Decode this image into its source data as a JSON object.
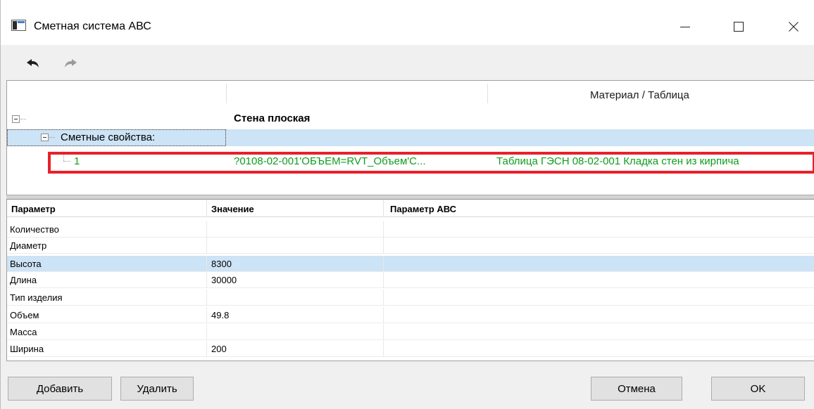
{
  "window": {
    "title": "Сметная система АВС"
  },
  "icons": {
    "app": "app-window-icon",
    "minimize": "minimize-icon",
    "maximize": "maximize-icon",
    "close": "close-icon",
    "undo": "undo-arrow-icon",
    "redo": "redo-arrow-icon"
  },
  "tree": {
    "column_header": "Материал / Таблица",
    "root_label": "Стена плоская",
    "group_label": "Сметные свойства:",
    "item": {
      "name": "1",
      "formula": "?0108-02-001'ОБЪЕМ=RVT_Объем'С...",
      "table": "Таблица ГЭСН 08-02-001 Кладка стен из кирпича"
    }
  },
  "grid": {
    "columns": [
      "Параметр",
      "Значение",
      "Параметр АВС"
    ],
    "rows": [
      {
        "param": "Количество",
        "value": "",
        "abc": ""
      },
      {
        "param": "Диаметр",
        "value": "",
        "abc": ""
      },
      {
        "param": "Высота",
        "value": "8300",
        "abc": ""
      },
      {
        "param": "Длина",
        "value": "30000",
        "abc": ""
      },
      {
        "param": "Тип изделия",
        "value": "",
        "abc": ""
      },
      {
        "param": "Объем",
        "value": "49.8",
        "abc": ""
      },
      {
        "param": "Масса",
        "value": "",
        "abc": ""
      },
      {
        "param": "Ширина",
        "value": "200",
        "abc": ""
      }
    ]
  },
  "buttons": {
    "add": "Добавить",
    "delete": "Удалить",
    "cancel": "Отмена",
    "ok": "OK"
  },
  "colors": {
    "selection": "#cde3f6",
    "green_text": "#0f9d1c",
    "highlight_border": "#e8202a"
  }
}
